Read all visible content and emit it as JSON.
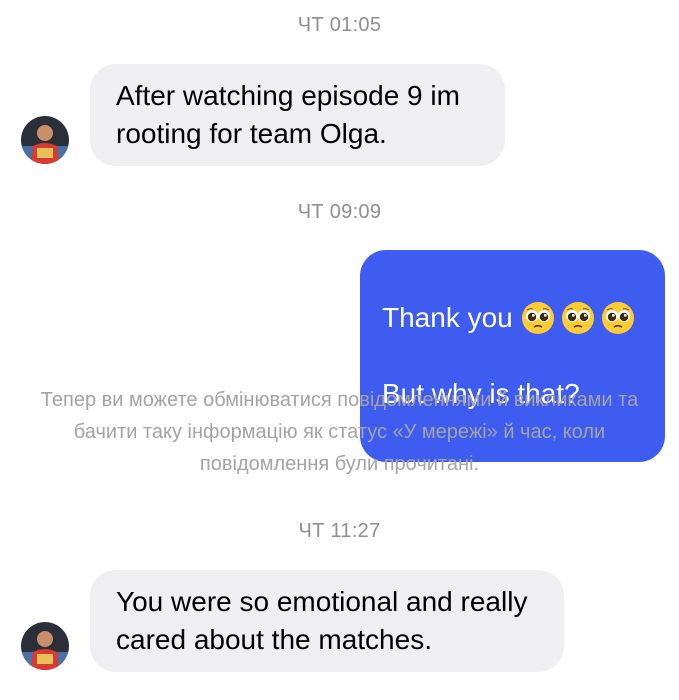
{
  "conversation": {
    "messages": [
      {
        "timestamp": "ЧТ 01:05",
        "direction": "incoming",
        "text": "After watching episode 9 im\nrooting for team Olga."
      },
      {
        "timestamp": "ЧТ 09:09",
        "direction": "outgoing",
        "line1": "Thank you",
        "line2": "But why is that?",
        "emojis": [
          "pleading-face",
          "pleading-face",
          "pleading-face"
        ]
      },
      {
        "system_note": "Тепер ви можете обмінюватися повідомленнями й викликами та бачити таку інформацію як статус «У мережі» й час, коли повідомлення були прочитані."
      },
      {
        "timestamp": "ЧТ 11:27",
        "direction": "incoming",
        "text": "You were so emotional and really\ncared about the matches."
      }
    ]
  },
  "colors": {
    "outgoing_bubble": "#3f5cf0",
    "incoming_bubble": "#efeff1",
    "timestamp_text": "#8e8e93",
    "system_text": "#a3a3a8"
  }
}
